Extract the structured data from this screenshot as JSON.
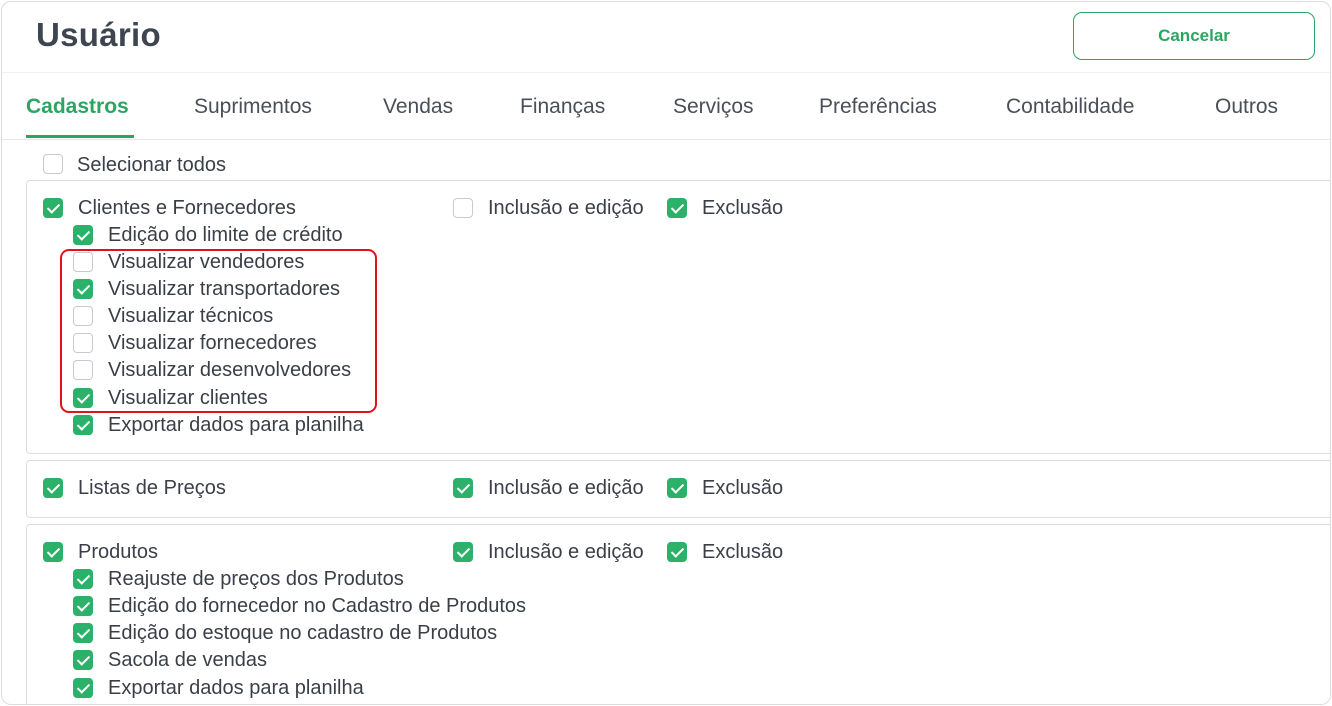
{
  "header": {
    "title": "Usuário",
    "cancel_label": "Cancelar"
  },
  "tabs": [
    {
      "label": "Cadastros",
      "active": true
    },
    {
      "label": "Suprimentos",
      "active": false
    },
    {
      "label": "Vendas",
      "active": false
    },
    {
      "label": "Finanças",
      "active": false
    },
    {
      "label": "Serviços",
      "active": false
    },
    {
      "label": "Preferências",
      "active": false
    },
    {
      "label": "Contabilidade",
      "active": false
    },
    {
      "label": "Outros",
      "active": false
    }
  ],
  "select_all": {
    "label": "Selecionar todos",
    "checked": false
  },
  "clientes": {
    "label": "Clientes e Fornecedores",
    "checked": true,
    "inclusao": {
      "label": "Inclusão e edição",
      "checked": false
    },
    "exclusao": {
      "label": "Exclusão",
      "checked": true
    },
    "items": [
      {
        "label": "Edição do limite de crédito",
        "checked": true
      },
      {
        "label": "Visualizar vendedores",
        "checked": false
      },
      {
        "label": "Visualizar transportadores",
        "checked": true
      },
      {
        "label": "Visualizar técnicos",
        "checked": false
      },
      {
        "label": "Visualizar fornecedores",
        "checked": false
      },
      {
        "label": "Visualizar desenvolvedores",
        "checked": false
      },
      {
        "label": "Visualizar clientes",
        "checked": true
      },
      {
        "label": "Exportar dados para planilha",
        "checked": true
      }
    ]
  },
  "listas": {
    "label": "Listas de Preços",
    "checked": true,
    "inclusao": {
      "label": "Inclusão e edição",
      "checked": true
    },
    "exclusao": {
      "label": "Exclusão",
      "checked": true
    }
  },
  "produtos": {
    "label": "Produtos",
    "checked": true,
    "inclusao": {
      "label": "Inclusão e edição",
      "checked": true
    },
    "exclusao": {
      "label": "Exclusão",
      "checked": true
    },
    "items": [
      {
        "label": "Reajuste de preços dos Produtos",
        "checked": true
      },
      {
        "label": "Edição do fornecedor no Cadastro de Produtos",
        "checked": true
      },
      {
        "label": "Edição do estoque no cadastro de Produtos",
        "checked": true
      },
      {
        "label": "Sacola de vendas",
        "checked": true
      },
      {
        "label": "Exportar dados para planilha",
        "checked": true
      }
    ]
  },
  "colors": {
    "accent": "#2bb169",
    "highlight": "#e0121c"
  }
}
